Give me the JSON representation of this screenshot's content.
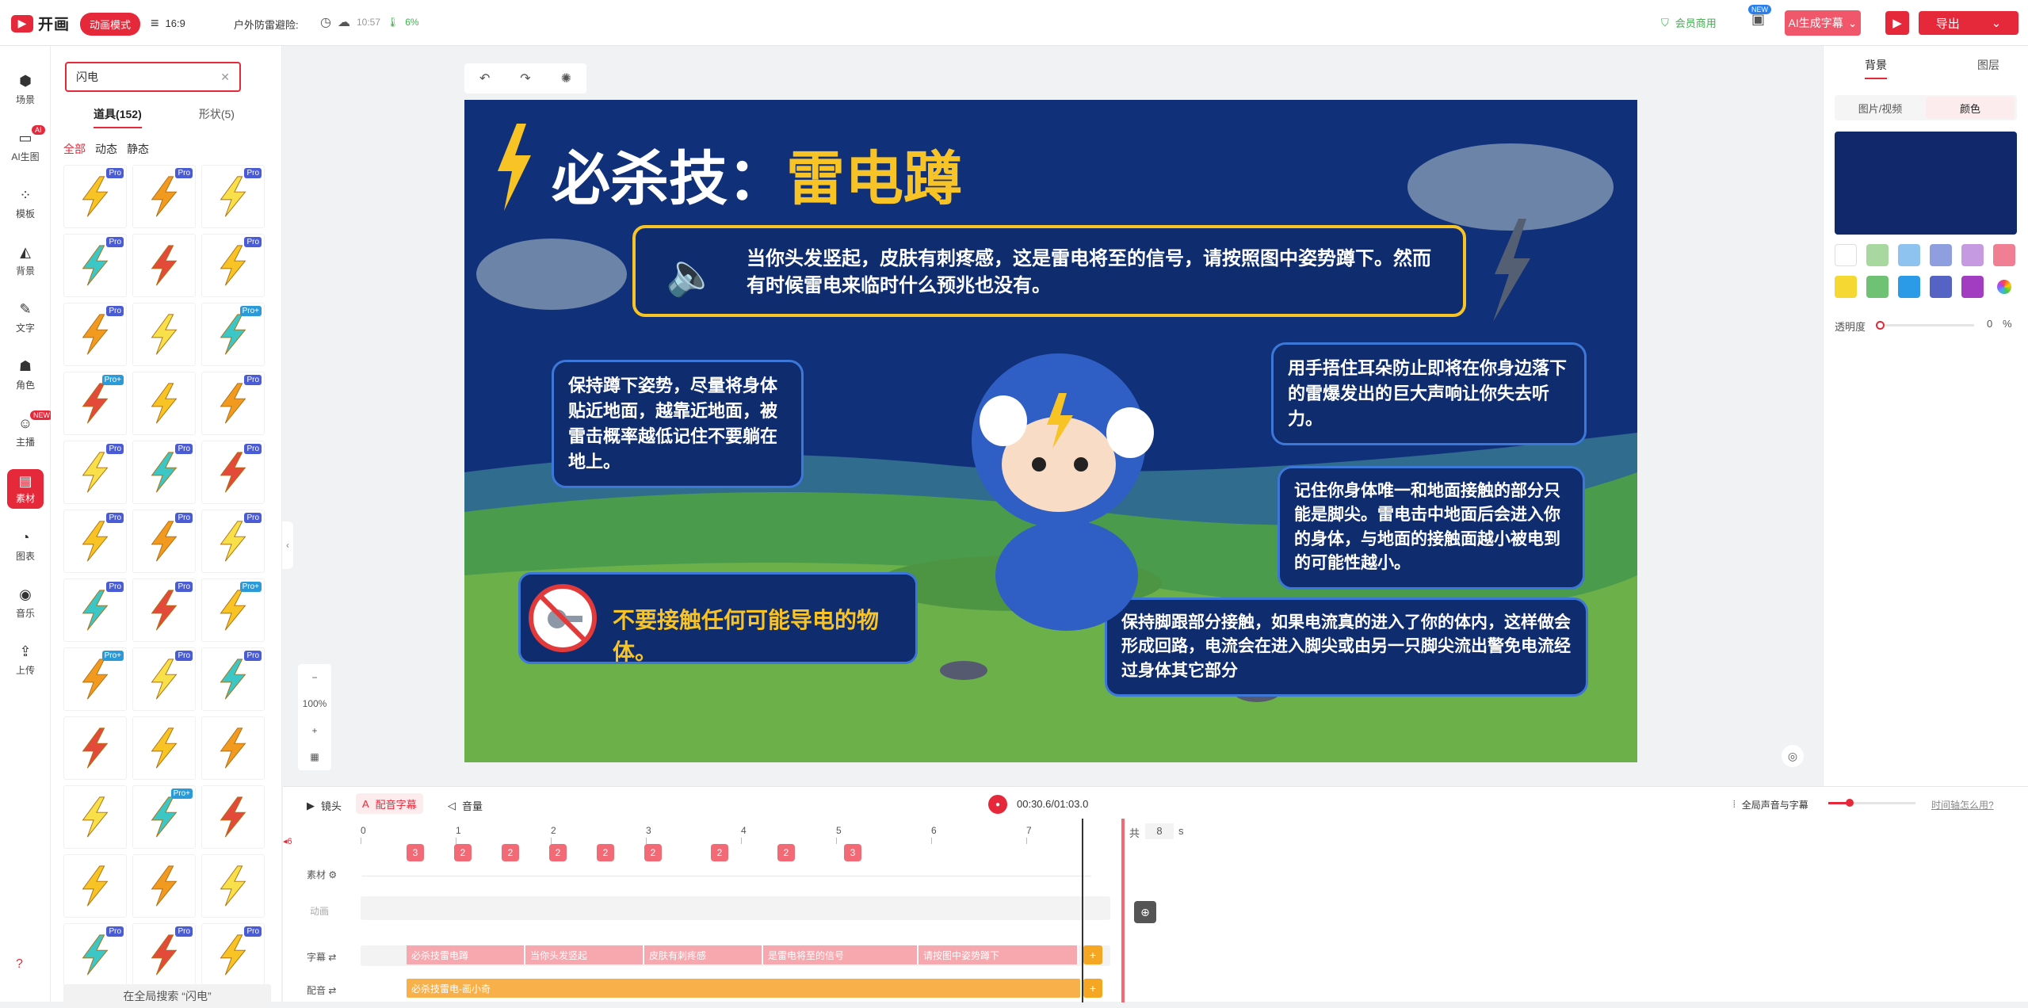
{
  "topbar": {
    "logo": "开画",
    "mode_badge": "动画模式",
    "ratio": "16:9",
    "project_title": "户外防雷避险:",
    "time": "10:57",
    "progress": "6%",
    "member": "会员商用",
    "new_badge": "NEW",
    "ai_subtitle": "AI生成字幕",
    "export": "导出"
  },
  "leftnav": [
    {
      "label": "场景",
      "icon": "scene-icon"
    },
    {
      "label": "AI生图",
      "icon": "ai-image-icon",
      "badge": "AI"
    },
    {
      "label": "模板",
      "icon": "template-icon"
    },
    {
      "label": "背景",
      "icon": "background-icon"
    },
    {
      "label": "文字",
      "icon": "text-icon"
    },
    {
      "label": "角色",
      "icon": "character-icon"
    },
    {
      "label": "主播",
      "icon": "anchor-icon",
      "badge": "NEW"
    },
    {
      "label": "素材",
      "icon": "material-icon"
    },
    {
      "label": "图表",
      "icon": "chart-icon"
    },
    {
      "label": "音乐",
      "icon": "music-icon"
    },
    {
      "label": "上传",
      "icon": "upload-icon"
    }
  ],
  "panel": {
    "search_value": "闪电",
    "tab_props": "道具(152)",
    "tab_shapes": "形状(5)",
    "filters": [
      "全部",
      "动态",
      "静态"
    ],
    "global_search": "在全局搜索 “闪电”",
    "items": [
      "pro",
      "pro",
      "pro",
      "pro",
      "none",
      "pro",
      "pro",
      "none",
      "pro+",
      "pro+",
      "none",
      "pro",
      "pro",
      "pro",
      "pro",
      "pro",
      "pro",
      "pro",
      "pro",
      "pro",
      "pro+",
      "pro+",
      "pro",
      "pro",
      "none",
      "none",
      "none",
      "none",
      "pro+",
      "none",
      "none",
      "none",
      "none",
      "pro",
      "pro",
      "pro"
    ]
  },
  "canvas": {
    "title_prefix": "必杀技：",
    "title_highlight": "雷电蹲",
    "intro": "当你头发竖起，皮肤有刺疼感，这是雷电将至的信号，请按照图中姿势蹲下。然而有时候雷电来临时什么预兆也没有。",
    "b1": "保持蹲下姿势，尽量将身体贴近地面，越靠近地面，被雷击概率越低记住不要躺在地上。",
    "b2": "用手捂住耳朵防止即将在你身边落下的雷爆发出的巨大声响让你失去听力。",
    "b3": "记住你身体唯一和地面接触的部分只能是脚尖。雷电击中地面后会进入你的身体，与地面的接触面越小被电到的可能性越小。",
    "b4": "保持脚跟部分接触，如果电流真的进入了你的体内，这样做会形成回路，电流会在进入脚尖或由另一只脚尖流出警免电流经过身体其它部分",
    "warn": "不要接触任何可能导电的物体。"
  },
  "zoom": {
    "level": "100%"
  },
  "right": {
    "tab_bg": "背景",
    "tab_layer": "图层",
    "sub_media": "图片/视频",
    "sub_color": "颜色",
    "opacity_label": "透明度",
    "opacity_value": "0",
    "pct": "%",
    "current_color": "#11286a",
    "swatches": [
      "#ffffff",
      "#a8d8a0",
      "#8ec3f0",
      "#8f9edf",
      "#c69ae0",
      "#f07f94",
      "#f6d832",
      "#6fc273",
      "#2b9be8",
      "#5564c4",
      "#a23cc1",
      "#multi"
    ]
  },
  "timeline": {
    "lens": "镜头",
    "dub": "配音字幕",
    "volume": "音量",
    "time": "00:30.6/01:03.0",
    "global_sound": "全局声音与字幕",
    "help": "时间轴怎么用?",
    "total": "共",
    "total_val": "8",
    "unit": "s",
    "ticks": [
      "0",
      "1",
      "2",
      "3",
      "4",
      "5",
      "6",
      "7"
    ],
    "markers": [
      "3",
      "2",
      "2",
      "2",
      "2",
      "2",
      "2",
      "2",
      "3"
    ],
    "row_material": "素材",
    "row_anim": "动画",
    "row_sub": "字幕",
    "row_voice": "配音",
    "subs": [
      "必杀技雷电蹲",
      "当你头发竖起",
      "皮肤有刺疼感",
      "是雷电将至的信号",
      "请按图中姿势蹲下"
    ],
    "voice": "必杀技雷电-画小奇",
    "edge_label": "6"
  }
}
